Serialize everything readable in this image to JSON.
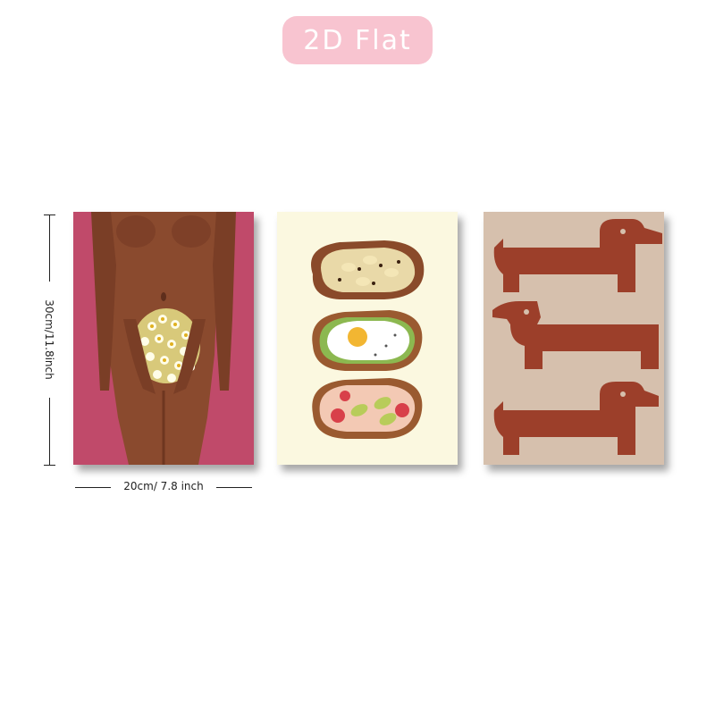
{
  "badge": {
    "label": "2D Flat",
    "color": "#f8c4d0"
  },
  "dimensions": {
    "width_label": "20cm/ 7.8 inch",
    "height_label": "30cm/11.8inch"
  },
  "posters": [
    {
      "subject": "nude-figure-with-daisies",
      "background": "#c04a6a"
    },
    {
      "subject": "three-toasts",
      "background": "#fbf8e0"
    },
    {
      "subject": "three-dachshunds",
      "background": "#d6c0ad"
    }
  ]
}
